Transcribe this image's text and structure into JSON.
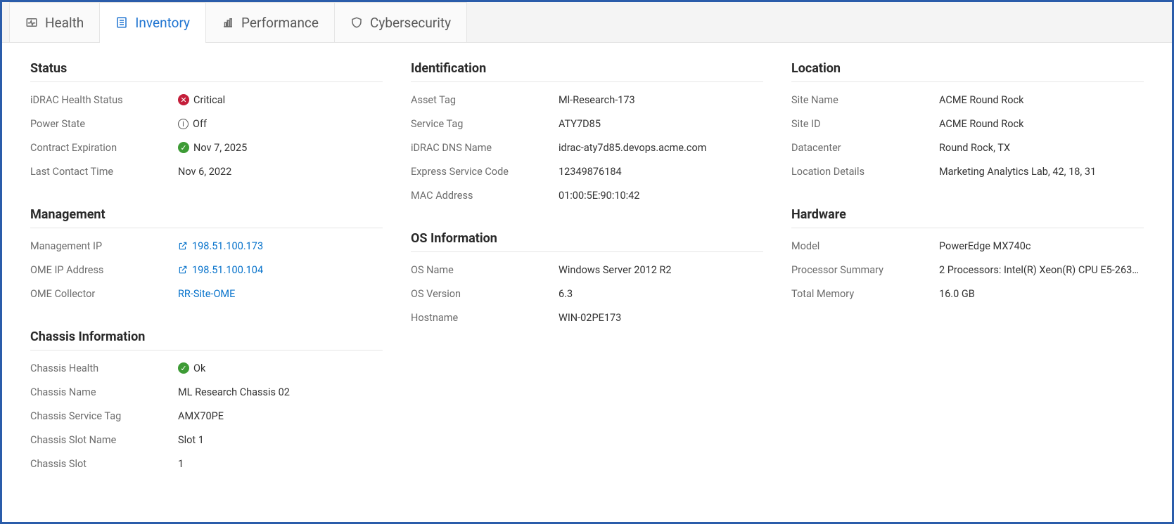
{
  "tabs": {
    "health": {
      "label": "Health"
    },
    "inventory": {
      "label": "Inventory"
    },
    "performance": {
      "label": "Performance"
    },
    "cybersecurity": {
      "label": "Cybersecurity"
    }
  },
  "status": {
    "title": "Status",
    "idrac_health_label": "iDRAC Health Status",
    "idrac_health_value": "Critical",
    "power_state_label": "Power State",
    "power_state_value": "Off",
    "contract_label": "Contract Expiration",
    "contract_value": "Nov 7, 2025",
    "last_contact_label": "Last Contact Time",
    "last_contact_value": "Nov 6, 2022"
  },
  "identification": {
    "title": "Identification",
    "asset_tag_label": "Asset Tag",
    "asset_tag_value": "Ml-Research-173",
    "service_tag_label": "Service Tag",
    "service_tag_value": "ATY7D85",
    "dns_label": "iDRAC DNS Name",
    "dns_value": "idrac-aty7d85.devops.acme.com",
    "express_label": "Express Service Code",
    "express_value": "12349876184",
    "mac_label": "MAC Address",
    "mac_value": "01:00:5E:90:10:42"
  },
  "location": {
    "title": "Location",
    "site_name_label": "Site Name",
    "site_name_value": "ACME Round Rock",
    "site_id_label": "Site ID",
    "site_id_value": "ACME Round Rock",
    "dc_label": "Datacenter",
    "dc_value": "Round Rock, TX",
    "details_label": "Location Details",
    "details_value": "Marketing Analytics Lab, 42, 18, 31"
  },
  "management": {
    "title": "Management",
    "mgmt_ip_label": "Management IP",
    "mgmt_ip_value": "198.51.100.173",
    "ome_ip_label": "OME IP Address",
    "ome_ip_value": "198.51.100.104",
    "ome_col_label": "OME Collector",
    "ome_col_value": "RR-Site-OME"
  },
  "os": {
    "title": "OS Information",
    "name_label": "OS Name",
    "name_value": "Windows Server 2012 R2",
    "version_label": "OS Version",
    "version_value": "6.3",
    "host_label": "Hostname",
    "host_value": "WIN-02PE173"
  },
  "hardware": {
    "title": "Hardware",
    "model_label": "Model",
    "model_value": "PowerEdge MX740c",
    "proc_label": "Processor Summary",
    "proc_value": "2 Processors: Intel(R) Xeon(R) CPU E5-263…",
    "mem_label": "Total Memory",
    "mem_value": "16.0 GB"
  },
  "chassis": {
    "title": "Chassis Information",
    "health_label": "Chassis Health",
    "health_value": "Ok",
    "name_label": "Chassis Name",
    "name_value": "ML Research Chassis 02",
    "svctag_label": "Chassis Service Tag",
    "svctag_value": "AMX70PE",
    "slotname_label": "Chassis Slot Name",
    "slotname_value": "Slot 1",
    "slot_label": "Chassis Slot",
    "slot_value": "1"
  }
}
